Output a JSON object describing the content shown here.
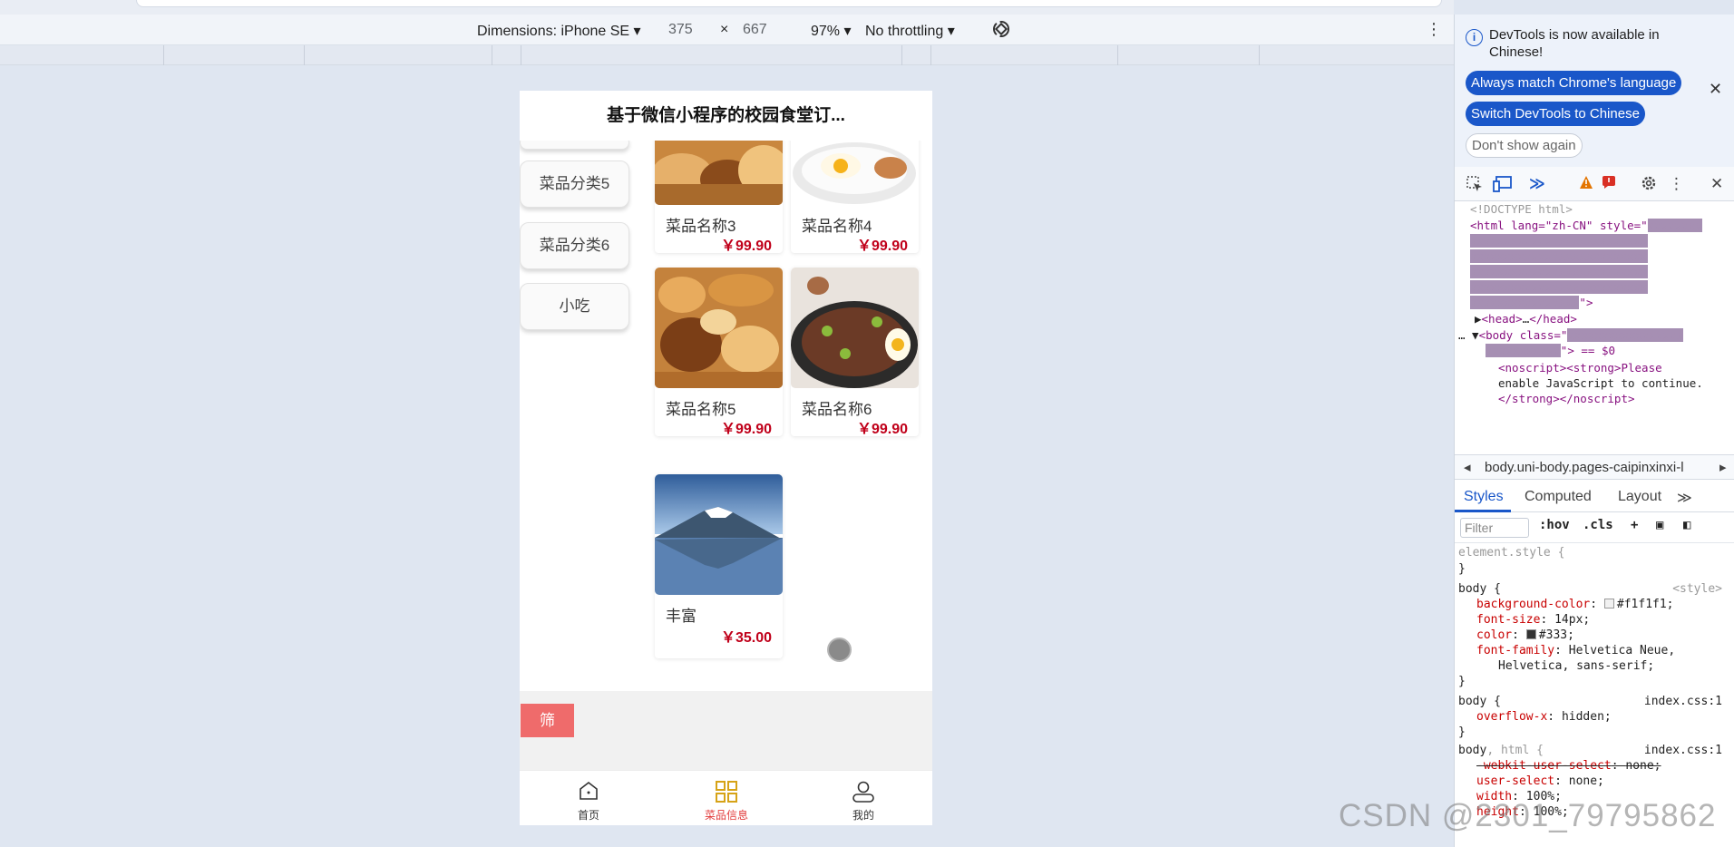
{
  "device_toolbar": {
    "dimensions_label": "Dimensions: iPhone SE",
    "width": "375",
    "times": "×",
    "height": "667",
    "zoom": "97%",
    "throttling": "No throttling"
  },
  "app": {
    "title": "基于微信小程序的校园食堂订...",
    "categories": [
      "菜品分类5",
      "菜品分类6",
      "小吃"
    ],
    "dishes": [
      {
        "name": "菜品名称3",
        "price": "￥99.90"
      },
      {
        "name": "菜品名称4",
        "price": "￥99.90"
      },
      {
        "name": "菜品名称5",
        "price": "￥99.90"
      },
      {
        "name": "菜品名称6",
        "price": "￥99.90"
      },
      {
        "name": "丰富",
        "price": "￥35.00"
      }
    ],
    "filter_label": "筛",
    "tabs": [
      {
        "label": "首页",
        "icon": "home-icon",
        "active": false
      },
      {
        "label": "菜品信息",
        "icon": "grid-icon",
        "active": true
      },
      {
        "label": "我的",
        "icon": "user-icon",
        "active": false
      }
    ],
    "accent_color": "#e23b3b",
    "price_color": "#c0001a"
  },
  "devtools": {
    "notice": "DevTools is now available in Chinese!",
    "btn_match": "Always match Chrome's language",
    "btn_switch": "Switch DevTools to Chinese",
    "btn_dont_show": "Don't show again",
    "dom": {
      "doctype": "<!DOCTYPE html>",
      "html_open": "<html lang=\"zh-CN\" style=\"",
      "html_close": "\">",
      "head": "<head>",
      "head_ellipsis": "…",
      "head_close": "</head>",
      "body_open": "<body class=\"",
      "body_suffix": "\"> == $0",
      "noscript1": "<noscript><strong>Please",
      "noscript2": "enable JavaScript to continue.",
      "noscript3": "</strong></noscript>"
    },
    "breadcrumb": "body.uni-body.pages-caipinxinxi-l",
    "style_tabs": [
      "Styles",
      "Computed",
      "Layout"
    ],
    "filter_placeholder": "Filter",
    "hov": ":hov",
    "cls": ".cls",
    "rules": {
      "element_style": "element.style {",
      "close": "}",
      "body_sel": "body {",
      "src_style": "<style>",
      "bg_prop": "background-color",
      "bg_val": "#f1f1f1;",
      "fs_prop": "font-size",
      "fs_val": "14px;",
      "color_prop": "color",
      "color_val": "#333;",
      "ff_prop": "font-family",
      "ff_val1": "Helvetica Neue,",
      "ff_val2": "Helvetica, sans-serif;",
      "src_index": "index.css:1",
      "overflow_prop": "overflow-x",
      "overflow_val": "hidden;",
      "body_html_sel": "body",
      "body_html_sel2": ", html {",
      "wus_prop": "-webkit-user-select",
      "wus_val": "none;",
      "us_prop": "user-select",
      "us_val": "none;",
      "w_prop": "width",
      "w_val": "100%;",
      "h_prop": "height",
      "h_val": "100%;"
    }
  },
  "watermark": "CSDN @2301_79795862"
}
